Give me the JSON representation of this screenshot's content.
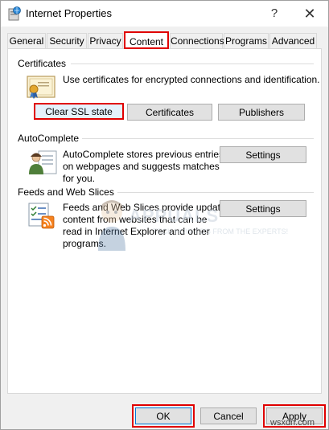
{
  "window": {
    "title": "Internet Properties",
    "help_glyph": "?",
    "close_glyph": "✕"
  },
  "tabs": [
    {
      "label": "General"
    },
    {
      "label": "Security"
    },
    {
      "label": "Privacy"
    },
    {
      "label": "Content",
      "active": true
    },
    {
      "label": "Connections"
    },
    {
      "label": "Programs"
    },
    {
      "label": "Advanced"
    }
  ],
  "certificates": {
    "heading": "Certificates",
    "description": "Use certificates for encrypted connections and identification.",
    "clear_ssl_label": "Clear SSL state",
    "certificates_label": "Certificates",
    "publishers_label": "Publishers"
  },
  "autocomplete": {
    "heading": "AutoComplete",
    "description_lines": [
      "AutoComplete stores previous entries",
      "on webpages and suggests matches",
      "for you."
    ],
    "settings_label": "Settings"
  },
  "feeds": {
    "heading": "Feeds and Web Slices",
    "description_lines": [
      "Feeds and Web Slices provide updated",
      "content from websites that can be",
      "read in Internet Explorer and other",
      "programs."
    ],
    "settings_label": "Settings"
  },
  "watermark": {
    "main": "APPUALS",
    "sub": "TECH HOW-TO'S FROM THE EXPERTS!"
  },
  "footer": {
    "ok_label": "OK",
    "cancel_label": "Cancel",
    "apply_label": "Apply",
    "site": "wsxdn.com"
  }
}
